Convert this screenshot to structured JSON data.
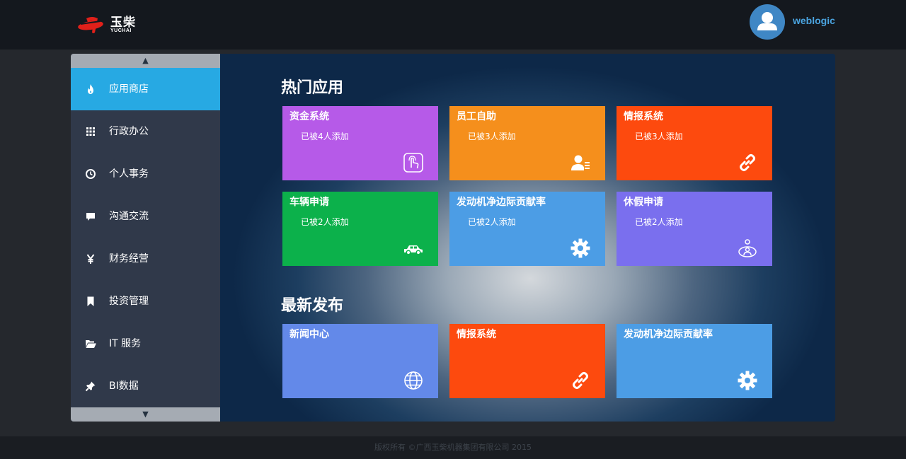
{
  "header": {
    "logo_text": "玉柴",
    "logo_sub": "YUCHAI",
    "username": "weblogic"
  },
  "sidebar": {
    "scroll_up": "▲",
    "scroll_down": "▼",
    "items": [
      {
        "label": "应用商店",
        "icon": "fire-icon",
        "active": true
      },
      {
        "label": "行政办公",
        "icon": "grid-icon"
      },
      {
        "label": "个人事务",
        "icon": "clock-icon"
      },
      {
        "label": "沟通交流",
        "icon": "chat-icon"
      },
      {
        "label": "财务经营",
        "icon": "yen-icon"
      },
      {
        "label": "投资管理",
        "icon": "bookmark-icon"
      },
      {
        "label": "IT 服务",
        "icon": "folder-open-icon"
      },
      {
        "label": "BI数据",
        "icon": "pin-icon"
      }
    ]
  },
  "hot": {
    "title": "热门应用",
    "tiles": [
      {
        "title": "资金系统",
        "sub": "已被4人添加",
        "color": "#b65ae8",
        "icon": "touch-icon"
      },
      {
        "title": "员工自助",
        "sub": "已被3人添加",
        "color": "#f58f1c",
        "icon": "user-card-icon"
      },
      {
        "title": "情报系统",
        "sub": "已被3人添加",
        "color": "#fd4a0e",
        "icon": "link-icon"
      },
      {
        "title": "车辆申请",
        "sub": "已被2人添加",
        "color": "#0cb14b",
        "icon": "car-icon"
      },
      {
        "title": "发动机净边际贡献率",
        "sub": "已被2人添加",
        "color": "#4c9de5",
        "icon": "gear-icon"
      },
      {
        "title": "休假申请",
        "sub": "已被2人添加",
        "color": "#7a6fee",
        "icon": "person-circle-icon"
      }
    ]
  },
  "latest": {
    "title": "最新发布",
    "tiles": [
      {
        "title": "新闻中心",
        "color": "#6389e9",
        "icon": "globe-icon"
      },
      {
        "title": "情报系统",
        "color": "#fd4a0e",
        "icon": "link-icon"
      },
      {
        "title": "发动机净边际贡献率",
        "color": "#4c9de5",
        "icon": "gear-icon"
      }
    ]
  },
  "footer": {
    "text": "版权所有 ©广西玉柴机器集团有限公司 2015"
  }
}
